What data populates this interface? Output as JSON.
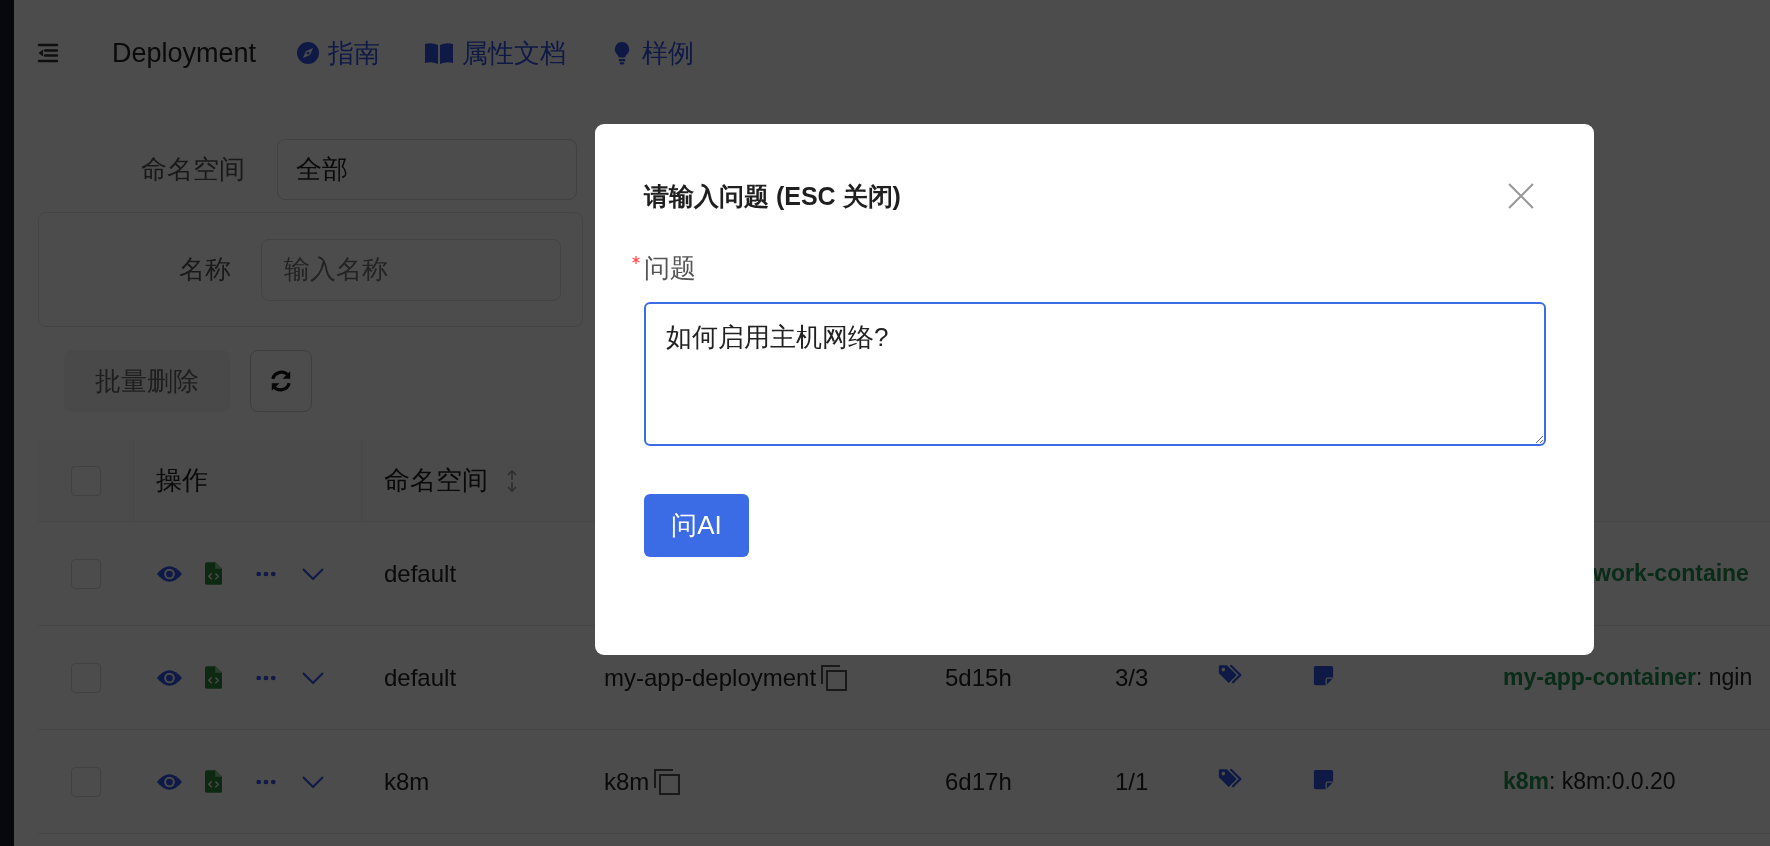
{
  "header": {
    "title": "Deployment",
    "links": [
      {
        "label": "指南"
      },
      {
        "label": "属性文档"
      },
      {
        "label": "样例"
      }
    ]
  },
  "filters": {
    "namespace_label": "命名空间",
    "namespace_value": "全部",
    "name_label": "名称",
    "name_placeholder": "输入名称"
  },
  "toolbar": {
    "batch_delete": "批量删除",
    "batch_delete_disabled": true
  },
  "table": {
    "columns": [
      "操作",
      "命名空间"
    ],
    "all_checked": false,
    "rows": [
      {
        "checked": false,
        "covered": true,
        "namespace": "default",
        "containers": "**work-containe**"
      },
      {
        "checked": false,
        "covered": false,
        "namespace": "default",
        "name": "my-app-deployment",
        "age": "5d15h",
        "ready": "3/3",
        "containers": "**my-app-container**: ngin"
      },
      {
        "checked": false,
        "covered": false,
        "namespace": "k8m",
        "name": "k8m",
        "age": "6d17h",
        "ready": "1/1",
        "containers": "**k8m**: k8m:0.0.20"
      }
    ]
  },
  "dialog": {
    "title": "请输入问题 (ESC 关闭)",
    "label": "问题",
    "required": true,
    "value": "如何启用主机网络?",
    "focused": true,
    "button": "问AI"
  }
}
